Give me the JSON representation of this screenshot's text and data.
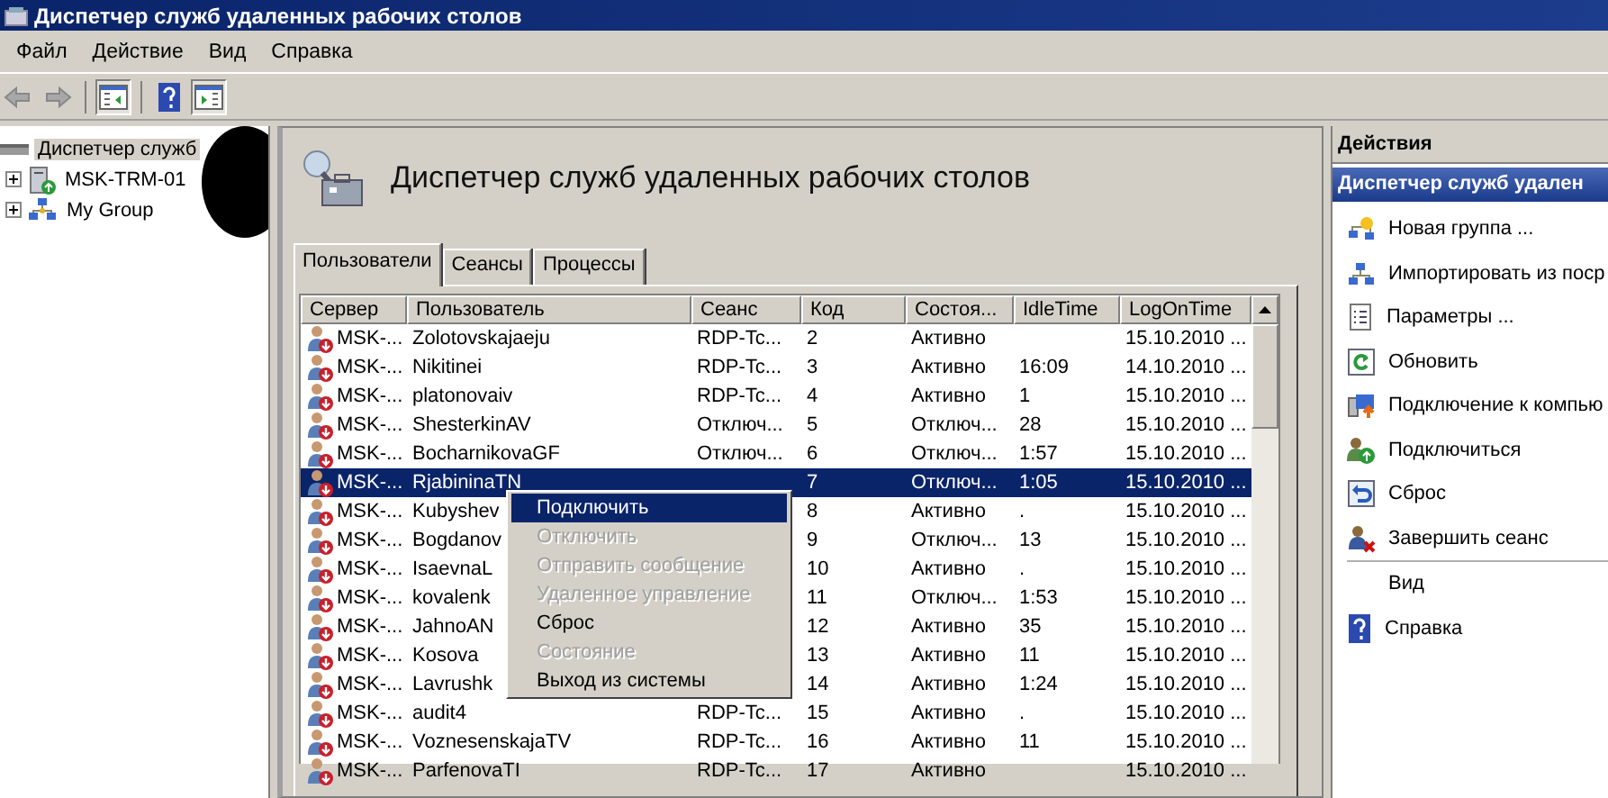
{
  "window": {
    "title": "Диспетчер служб удаленных рабочих столов"
  },
  "menu": [
    "Файл",
    "Действие",
    "Вид",
    "Справка"
  ],
  "toolbar": [
    {
      "kind": "back",
      "disabled": true
    },
    {
      "kind": "forward",
      "disabled": true
    },
    {
      "kind": "tree",
      "pressed": true
    },
    {
      "kind": "help",
      "pressed": false
    },
    {
      "kind": "actions",
      "pressed": true
    }
  ],
  "tree": {
    "label": "Диспетчер служб",
    "selected": true,
    "children": [
      {
        "label": "MSK-TRM-01",
        "kind": "server",
        "expanded": false,
        "selected": false
      },
      {
        "label": "My Group",
        "kind": "group",
        "expanded": false,
        "selected": false
      }
    ]
  },
  "heading": "Диспетчер служб удаленных рабочих столов",
  "tabs": [
    {
      "label": "Пользователи",
      "selected": true
    },
    {
      "label": "Сеансы",
      "selected": false
    },
    {
      "label": "Процессы",
      "selected": false
    }
  ],
  "table": {
    "columns": [
      "Сервер",
      "Пользователь",
      "Сеанс",
      "Код",
      "Состоя...",
      "IdleTime",
      "LogOnTime"
    ],
    "rows": [
      {
        "server": "MSK-...",
        "user": "Zolotovskajaeju",
        "session": "RDP-Tc...",
        "id": "2",
        "state": "Активно",
        "logon_time": "15.10.2010 ...",
        "selected": false
      },
      {
        "server": "MSK-...",
        "user": "Nikitinei",
        "session": "RDP-Tc...",
        "id": "3",
        "state": "Активно",
        "idle_time": "16:09",
        "logon_time": "14.10.2010 ...",
        "selected": false
      },
      {
        "server": "MSK-...",
        "user": "platonovaiv",
        "session": "RDP-Tc...",
        "id": "4",
        "state": "Активно",
        "idle_time": "1",
        "logon_time": "15.10.2010 ...",
        "selected": false
      },
      {
        "server": "MSK-...",
        "user": "ShesterkinAV",
        "session": "Отключ...",
        "id": "5",
        "state": "Отключ...",
        "idle_time": "28",
        "logon_time": "15.10.2010 ...",
        "selected": false
      },
      {
        "server": "MSK-...",
        "user": "BocharnikovaGF",
        "session": "Отключ...",
        "id": "6",
        "state": "Отключ...",
        "idle_time": "1:57",
        "logon_time": "15.10.2010 ...",
        "selected": false
      },
      {
        "server": "MSK-...",
        "user": "RjabininaTN",
        "id": "7",
        "state": "Отключ...",
        "idle_time": "1:05",
        "logon_time": "15.10.2010 ...",
        "selected": true
      },
      {
        "server": "MSK-...",
        "user": "Kubyshev",
        "id": "8",
        "state": "Активно",
        "idle_time": ".",
        "logon_time": "15.10.2010 ...",
        "selected": false
      },
      {
        "server": "MSK-...",
        "user": "Bogdanov",
        "id": "9",
        "state": "Отключ...",
        "idle_time": "13",
        "logon_time": "15.10.2010 ...",
        "selected": false
      },
      {
        "server": "MSK-...",
        "user": "IsaevnaL",
        "id": "10",
        "state": "Активно",
        "idle_time": ".",
        "logon_time": "15.10.2010 ...",
        "selected": false
      },
      {
        "server": "MSK-...",
        "user": "kovalenk",
        "id": "11",
        "state": "Отключ...",
        "idle_time": "1:53",
        "logon_time": "15.10.2010 ...",
        "selected": false
      },
      {
        "server": "MSK-...",
        "user": "JahnoAN",
        "id": "12",
        "state": "Активно",
        "idle_time": "35",
        "logon_time": "15.10.2010 ...",
        "selected": false
      },
      {
        "server": "MSK-...",
        "user": "Kosova",
        "id": "13",
        "state": "Активно",
        "idle_time": "11",
        "logon_time": "15.10.2010 ...",
        "selected": false
      },
      {
        "server": "MSK-...",
        "user": "Lavrushk",
        "id": "14",
        "state": "Активно",
        "idle_time": "1:24",
        "logon_time": "15.10.2010 ...",
        "selected": false
      },
      {
        "server": "MSK-...",
        "user": "audit4",
        "session": "RDP-Tc...",
        "id": "15",
        "state": "Активно",
        "idle_time": ".",
        "logon_time": "15.10.2010 ...",
        "selected": false
      },
      {
        "server": "MSK-...",
        "user": "VoznesenskajaTV",
        "session": "RDP-Tc...",
        "id": "16",
        "state": "Активно",
        "idle_time": "11",
        "logon_time": "15.10.2010 ...",
        "selected": false
      },
      {
        "server": "MSK-...",
        "user": "ParfenovaTI",
        "session": "RDP-Tc...",
        "id": "17",
        "state": "Активно",
        "logon_time": "15.10.2010 ...",
        "selected": false
      }
    ]
  },
  "context_menu": [
    {
      "label": "Подключить",
      "disabled": false,
      "selected": true
    },
    {
      "label": "Отключить",
      "disabled": true,
      "selected": false
    },
    {
      "label": "Отправить сообщение",
      "disabled": true,
      "selected": false
    },
    {
      "label": "Удаленное управление",
      "disabled": true,
      "selected": false
    },
    {
      "label": "Сброс",
      "disabled": false,
      "selected": false
    },
    {
      "label": "Состояние",
      "disabled": true,
      "selected": false
    },
    {
      "label": "Выход из системы",
      "disabled": false,
      "selected": false
    }
  ],
  "actions": {
    "title": "Действия",
    "section": "Диспетчер служб удален",
    "groups": [
      {
        "items": [
          {
            "label": "Новая группа ...",
            "kind": "new-group"
          },
          {
            "label": "Импортировать из поср",
            "kind": "import"
          },
          {
            "label": "Параметры ...",
            "kind": "options"
          },
          {
            "label": "Обновить",
            "kind": "refresh"
          },
          {
            "label": "Подключение к компью",
            "kind": "connect-computer"
          },
          {
            "label": "Подключиться",
            "kind": "connect"
          },
          {
            "label": "Сброс",
            "kind": "reset"
          },
          {
            "label": "Завершить сеанс",
            "kind": "logoff"
          }
        ]
      },
      {
        "items": [
          {
            "label": "Вид",
            "kind": "none"
          },
          {
            "label": "Справка",
            "kind": "help"
          }
        ]
      }
    ]
  }
}
